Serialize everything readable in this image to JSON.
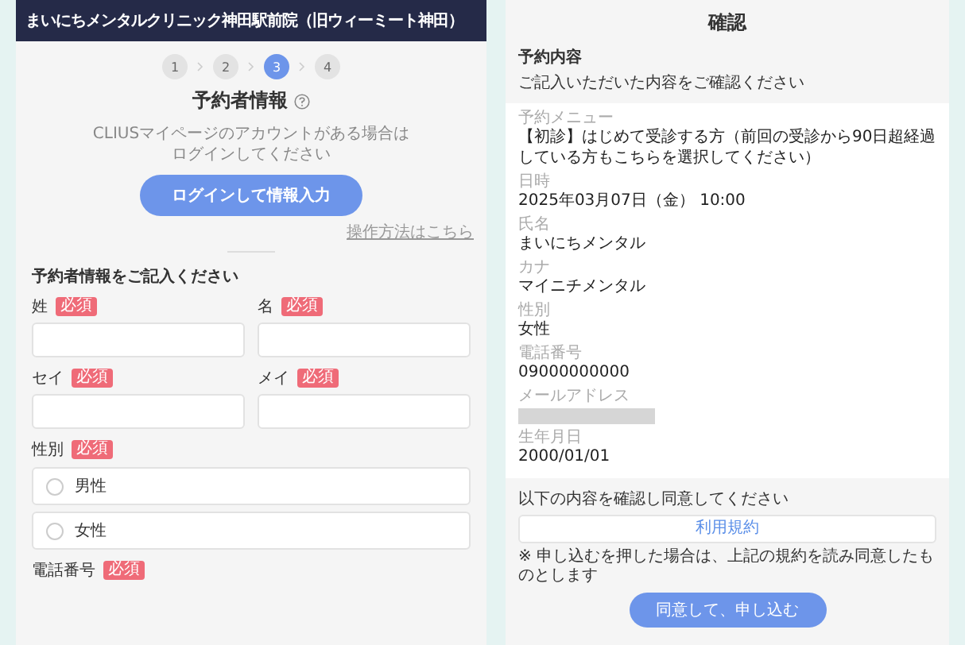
{
  "form_panel": {
    "header": "まいにちメンタルクリニック神田駅前院（旧ウィーミート神田）",
    "steps": [
      {
        "label": "1",
        "selected": false
      },
      {
        "label": "2",
        "selected": false
      },
      {
        "label": "3",
        "selected": true
      },
      {
        "label": "4",
        "selected": false
      }
    ],
    "title": "予約者情報",
    "note_lines": [
      "CLIUSマイページのアカウントがある場合は",
      "ログインしてください"
    ],
    "login_button": "ログインして情報入力",
    "help_link": "操作方法はこちら",
    "section_title": "予約者情報をご記入ください",
    "name_fields": [
      {
        "label": "姓",
        "badge": "必須"
      },
      {
        "label": "名",
        "badge": "必須"
      },
      {
        "label": "セイ",
        "badge": "必須"
      },
      {
        "label": "メイ",
        "badge": "必須"
      }
    ],
    "gender": {
      "label": "性別",
      "badge": "必須",
      "options": [
        {
          "label": "男性",
          "selected": false
        },
        {
          "label": "女性",
          "selected": false
        }
      ]
    },
    "phone": {
      "label": "電話番号",
      "badge": "必須"
    }
  },
  "confirm_panel": {
    "title": "確認",
    "section_title": "予約内容",
    "subtitle": "ご記入いただいた内容をご確認ください",
    "fields": [
      {
        "label": "予約メニュー",
        "value": "【初診】はじめて受診する方（前回の受診から90日超経過している方もこちらを選択してください）",
        "kind": "text"
      },
      {
        "label": "日時",
        "value": "2025年03月07日（金） 10:00",
        "kind": "text"
      },
      {
        "label": "氏名",
        "value": "まいにちメンタル",
        "kind": "text"
      },
      {
        "label": "カナ",
        "value": "マイニチメンタル",
        "kind": "text"
      },
      {
        "label": "性別",
        "value": "女性",
        "kind": "text"
      },
      {
        "label": "電話番号",
        "value": "09000000000",
        "kind": "text"
      },
      {
        "label": "メールアドレス",
        "kind": "redacted"
      },
      {
        "label": "生年月日",
        "value": "2000/01/01",
        "kind": "text"
      }
    ],
    "agree_text": "以下の内容を確認し同意してください",
    "terms_link": "利用規約",
    "notice": "※ 申し込むを押した場合は、上記の規約を読み同意したものとします",
    "submit_button": "同意して、申し込む"
  }
}
